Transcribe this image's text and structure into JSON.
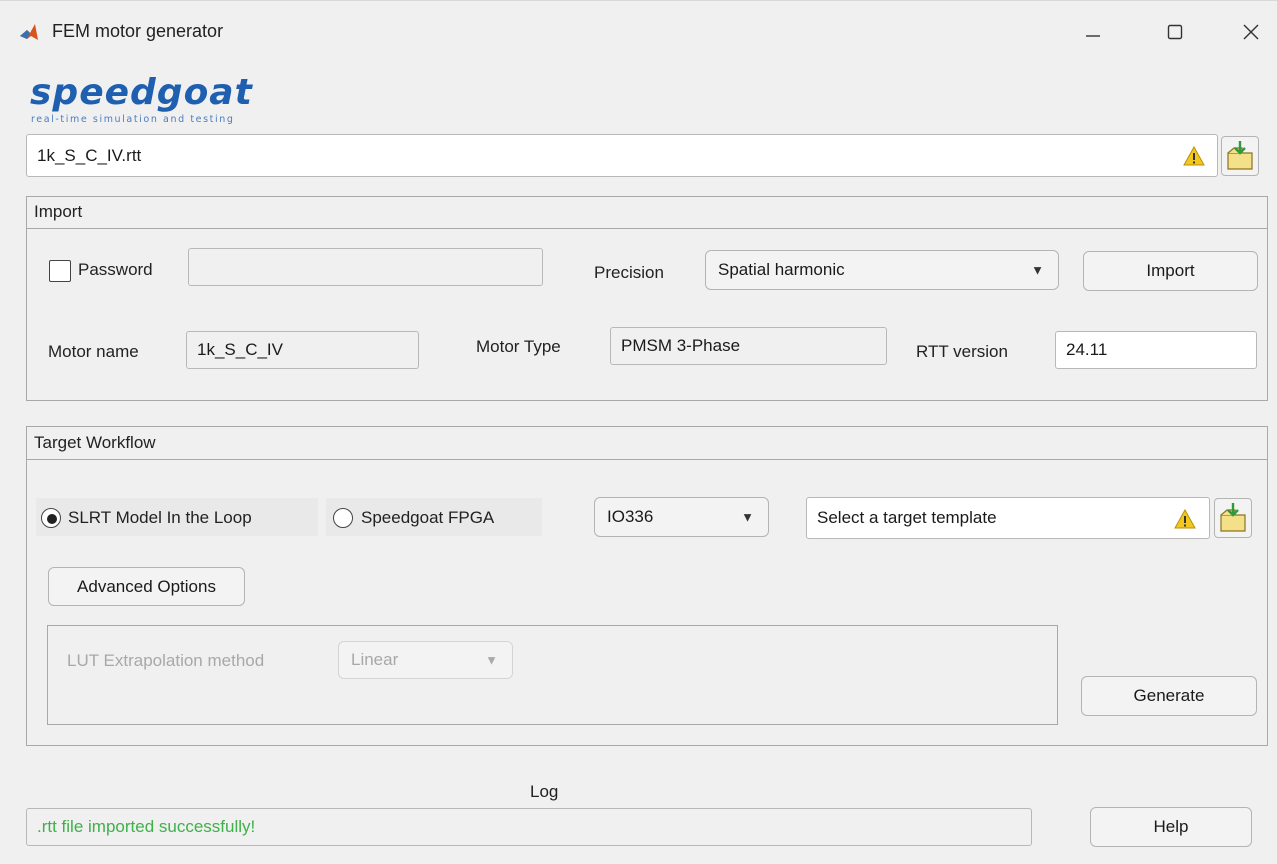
{
  "window": {
    "title": "FEM motor generator",
    "controls": [
      "minimize-icon",
      "maximize-icon",
      "close-icon"
    ]
  },
  "logo": {
    "main": "speedgoat",
    "tagline": "real-time simulation and testing",
    "brand_color": "#1f5fb0"
  },
  "file": {
    "path": "1k_S_C_IV.rtt",
    "icons": [
      "warning-icon",
      "folder-import-icon"
    ]
  },
  "import_panel": {
    "title": "Import",
    "password_label": "Password",
    "password_checked": false,
    "password_value": "",
    "precision_label": "Precision",
    "precision_value": "Spatial harmonic",
    "import_button": "Import",
    "motor_name_label": "Motor name",
    "motor_name_value": "1k_S_C_IV",
    "motor_type_label": "Motor Type",
    "motor_type_value": "PMSM 3-Phase",
    "rtt_version_label": "RTT version",
    "rtt_version_value": "24.11"
  },
  "workflow_panel": {
    "title": "Target Workflow",
    "radio_slrt": "SLRT Model In the Loop",
    "radio_slrt_selected": true,
    "radio_fpga": "Speedgoat FPGA",
    "radio_fpga_selected": false,
    "board_value": "IO336",
    "template_placeholder": "Select a target template",
    "advanced_button": "Advanced Options",
    "lut_label": "LUT Extrapolation method",
    "lut_value": "Linear",
    "generate_button": "Generate"
  },
  "log": {
    "label": "Log",
    "message": ".rtt file imported successfully!",
    "message_color": "#3fb04a",
    "help_button": "Help"
  }
}
